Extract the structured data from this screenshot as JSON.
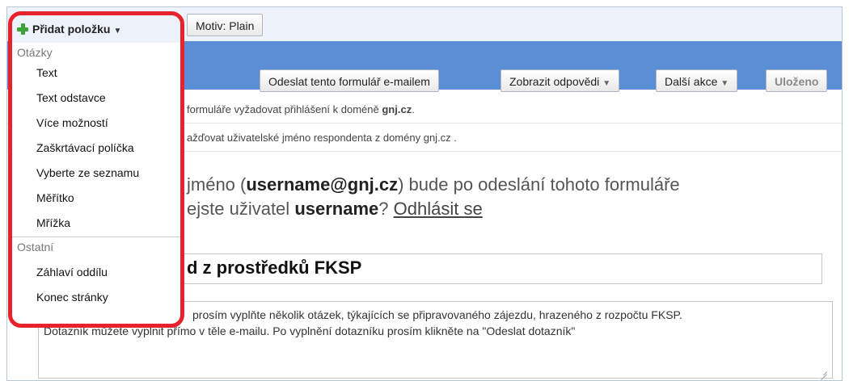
{
  "header": {
    "theme_label": "Motiv: Plain"
  },
  "toolbar": {
    "send_email": "Odeslat tento formulář e-mailem",
    "view_responses": "Zobrazit odpovědi",
    "more_actions": "Další akce",
    "saved": "Uloženo"
  },
  "notices": {
    "login_required_prefix": "formuláře vyžadovat přihlášení k doméně",
    "login_required_domain": "gnj.cz",
    "login_required_suffix": ".",
    "collect_username": "ažďovat uživatelské jméno respondenta z domény gnj.cz ."
  },
  "signin": {
    "line1_prefix": "jméno (",
    "line1_user": "username@gnj.cz",
    "line1_suffix": ") bude po odeslání tohoto formuláře",
    "line2_prefix": "ejste uživatel",
    "line2_user": "username",
    "line2_q": "?",
    "logout_link": "Odhlásit se"
  },
  "form": {
    "title": "d z prostředků FKSP",
    "description_line1": "prosím vyplňte několik otázek, týkajících se připravovaného zájezdu, hrazeného z rozpočtu FKSP.",
    "description_line2": "Dotazník můžete vyplnit přímo v těle e-mailu. Po vyplnění dotazníku prosím klikněte na \"Odeslat dotazník\""
  },
  "add_menu": {
    "button_label": "Přidat položku",
    "questions_header": "Otázky",
    "question_items": [
      "Text",
      "Text odstavce",
      "Více možností",
      "Zaškrtávací políčka",
      "Vyberte ze seznamu",
      "Měřítko",
      "Mřížka"
    ],
    "other_header": "Ostatní",
    "other_items": [
      "Záhlaví oddílu",
      "Konec stránky"
    ]
  },
  "colors": {
    "toolbar_bg": "#5b8fd5",
    "highlight": "#e8222c",
    "plus_icon": "#3fa33a"
  },
  "icons": {
    "add": "plus-icon",
    "dropdown": "chevron-down-icon",
    "resize": "resize-grip-icon"
  }
}
